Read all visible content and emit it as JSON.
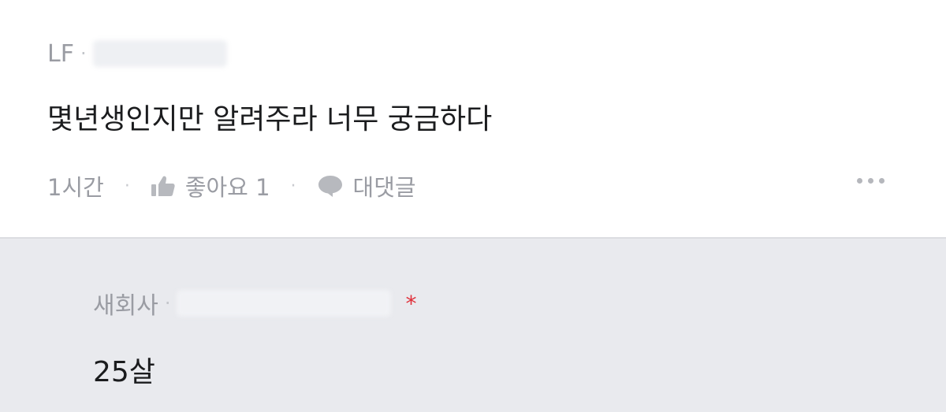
{
  "comment": {
    "author_prefix": "LF",
    "separator": "·",
    "text": "몇년생인지만 알려주라 너무 궁금하다",
    "time": "1시간",
    "like_label": "좋아요 1",
    "reply_label": "대댓글",
    "icons": {
      "like": "thumbs-up-icon",
      "reply": "speech-bubble-icon",
      "more": "more-dots-icon"
    }
  },
  "reply": {
    "author_prefix": "새회사",
    "separator": "·",
    "text": "25살",
    "author_badge": "*",
    "badge_color": "#e0303a"
  }
}
